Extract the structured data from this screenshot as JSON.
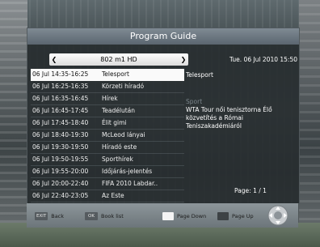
{
  "title": "Program Guide",
  "channel": "802 m1 HD",
  "datetime": "Tue.  06 Jul 2010 15:50",
  "program_list": [
    {
      "time": "06 Jul 14:35-16:25",
      "name": "Telesport"
    },
    {
      "time": "06 Jul 16:25-16:35",
      "name": "Körzeti híradó"
    },
    {
      "time": "06 Jul 16:35-16:45",
      "name": "Hírek"
    },
    {
      "time": "06 Jul 16:45-17:45",
      "name": "Teadélután"
    },
    {
      "time": "06 Jul 17:45-18:40",
      "name": "Élit gimi"
    },
    {
      "time": "06 Jul 18:40-19:30",
      "name": "McLeod lányai"
    },
    {
      "time": "06 Jul 19:30-19:50",
      "name": "Híradó este"
    },
    {
      "time": "06 Jul 19:50-19:55",
      "name": "Sporthírek"
    },
    {
      "time": "06 Jul 19:55-20:00",
      "name": "Időjárás-jelentés"
    },
    {
      "time": "06 Jul 20:00-22:40",
      "name": "FIFA 2010 Labdar.."
    },
    {
      "time": "06 Jul 22:40-23:05",
      "name": "Az Este"
    }
  ],
  "detail": {
    "title": "Telesport",
    "genre": "Sport",
    "description": "WTA Tour női tenisztorna Élő közvetítés a Római Teniszakadémiáról"
  },
  "page": "Page: 1 / 1",
  "footer": {
    "back_key": "EXIT",
    "back_label": "Back",
    "book_key": "OK",
    "book_label": "Book list",
    "page_down_label": "Page Down",
    "page_up_label": "Page Up"
  },
  "colors": {
    "panel": "#2e3436",
    "title_bar": "#6b7680",
    "selected_row": "#fafafa",
    "footer": "#7d868b"
  }
}
